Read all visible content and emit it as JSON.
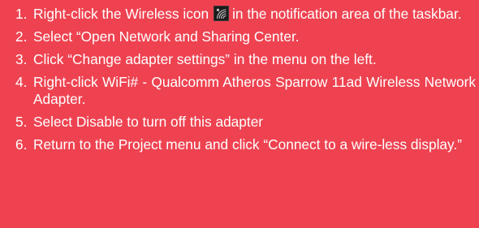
{
  "steps": [
    {
      "number": "1.",
      "text_before_icon": "Right-click the Wireless icon",
      "icon": "wireless-network-icon",
      "text_after_icon": "in the notification area of the taskbar."
    },
    {
      "number": "2.",
      "text": "Select “Open Network and Sharing Center."
    },
    {
      "number": "3.",
      "text": "Click “Change adapter settings” in the menu on the left."
    },
    {
      "number": "4.",
      "text": "Right-click WiFi# - Qualcomm Atheros Sparrow 11ad Wireless Network Adapter."
    },
    {
      "number": "5.",
      "text": "Select Disable to turn off this adapter"
    },
    {
      "number": "6.",
      "text": "Return to the Project menu and click “Connect to a wire-less display.”"
    }
  ],
  "colors": {
    "background": "#ee4250",
    "text": "#ffffff",
    "icon_background": "#1b1b1b"
  }
}
